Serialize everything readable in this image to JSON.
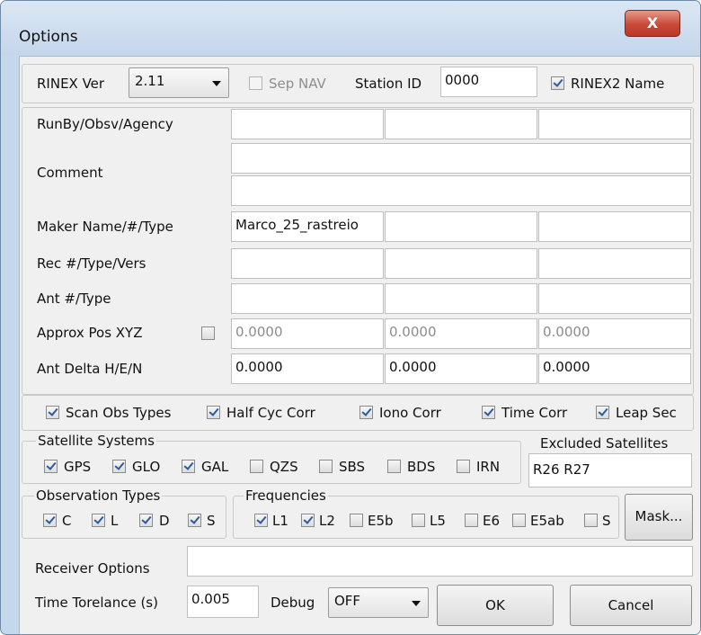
{
  "window": {
    "title": "Options",
    "close_glyph": "X"
  },
  "rinex_version": {
    "label": "RINEX Ver",
    "value": "2.11"
  },
  "sep_nav": {
    "label": "Sep NAV",
    "checked": false,
    "enabled": false
  },
  "station_id": {
    "label": "Station ID",
    "value": "0000"
  },
  "rinex2_name": {
    "label": "RINEX2 Name",
    "checked": true
  },
  "header_fields": {
    "runby_label": "RunBy/Obsv/Agency",
    "comment_label": "Comment",
    "maker_label": "Maker Name/#/Type",
    "maker_values": [
      "Marco_25_rastreio",
      "",
      ""
    ],
    "rec_label": "Rec #/Type/Vers",
    "ant_label": "Ant #/Type",
    "approx_pos_label": "Approx Pos XYZ",
    "approx_pos_checked": false,
    "approx_pos_values": [
      "0.0000",
      "0.0000",
      "0.0000"
    ],
    "ant_delta_label": "Ant Delta H/E/N",
    "ant_delta_values": [
      "0.0000",
      "0.0000",
      "0.0000"
    ]
  },
  "options": [
    {
      "label": "Scan Obs Types",
      "checked": true
    },
    {
      "label": "Half Cyc Corr",
      "checked": true
    },
    {
      "label": "Iono Corr",
      "checked": true
    },
    {
      "label": "Time Corr",
      "checked": true
    },
    {
      "label": "Leap Sec",
      "checked": true
    }
  ],
  "satellite_systems": {
    "title": "Satellite Systems",
    "items": [
      {
        "label": "GPS",
        "checked": true
      },
      {
        "label": "GLO",
        "checked": true
      },
      {
        "label": "GAL",
        "checked": true
      },
      {
        "label": "QZS",
        "checked": false
      },
      {
        "label": "SBS",
        "checked": false
      },
      {
        "label": "BDS",
        "checked": false
      },
      {
        "label": "IRN",
        "checked": false
      }
    ]
  },
  "excluded_satellites": {
    "label": "Excluded Satellites",
    "value": "R26 R27"
  },
  "observation_types": {
    "title": "Observation Types",
    "items": [
      {
        "label": "C",
        "checked": true
      },
      {
        "label": "L",
        "checked": true
      },
      {
        "label": "D",
        "checked": true
      },
      {
        "label": "S",
        "checked": true
      }
    ]
  },
  "frequencies": {
    "title": "Frequencies",
    "items": [
      {
        "label": "L1",
        "checked": true
      },
      {
        "label": "L2",
        "checked": true
      },
      {
        "label": "E5b",
        "checked": false
      },
      {
        "label": "L5",
        "checked": false
      },
      {
        "label": "E6",
        "checked": false
      },
      {
        "label": "E5ab",
        "checked": false
      },
      {
        "label": "S",
        "checked": false
      }
    ]
  },
  "mask_button": "Mask...",
  "receiver_options": {
    "label": "Receiver Options",
    "value": ""
  },
  "time_tolerance": {
    "label": "Time Torelance (s)",
    "value": "0.005"
  },
  "debug": {
    "label": "Debug",
    "value": "OFF"
  },
  "ok_button": "OK",
  "cancel_button": "Cancel"
}
